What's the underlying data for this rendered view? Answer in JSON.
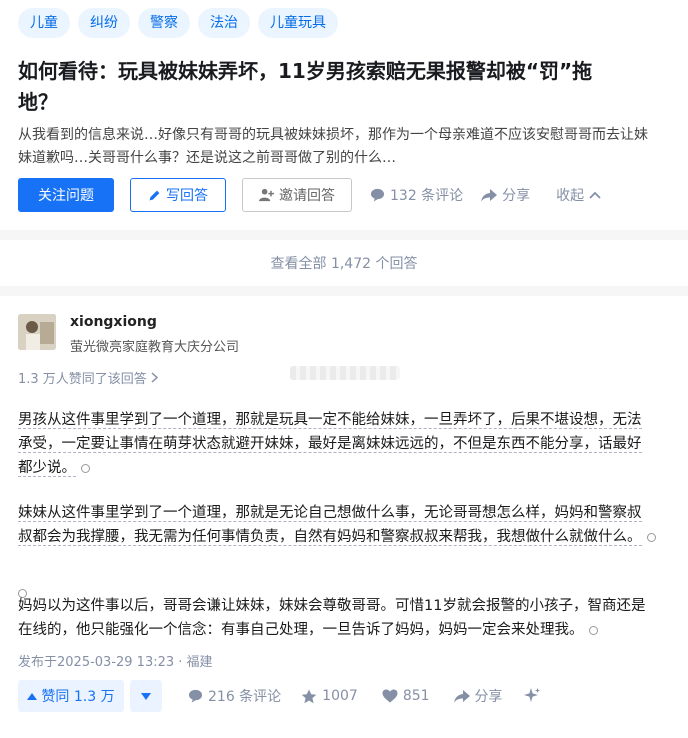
{
  "question": {
    "tags": [
      "儿童",
      "纠纷",
      "警察",
      "法治",
      "儿童玩具"
    ],
    "title_line1": "如何看待：玩具被妹妹弄坏，11岁男孩索赔无果报警却被“罚”拖",
    "title_line2": "地？",
    "desc_line1": "从我看到的信息来说…好像只有哥哥的玩具被妹妹损坏，那作为一个母亲难道不应该安慰哥哥而去让妹",
    "desc_line2": "妹道歉吗…关哥哥什么事？还是说这之前哥哥做了别的什么…",
    "follow_label": "关注问题",
    "write_label": "写回答",
    "invite_label": "邀请回答",
    "comments_label": "132 条评论",
    "share_label": "分享",
    "collapse_label": "收起"
  },
  "view_all": "查看全部 1,472 个回答",
  "answer": {
    "author": "xiongxiong",
    "bio": "萤光微亮家庭教育大庆分公司",
    "agree_summary": "1.3 万人赞同了该回答",
    "paragraphs": [
      {
        "lines": [
          "男孩从这件事里学到了一个道理，那就是玩具一定不能给妹妹，一旦弄坏了，后果不堪设想，无法",
          "承受，一定要让事情在萌芽状态就避开妹妹，最好是离妹妹远远的，不但是东西不能分享，话最好",
          "都少说。"
        ]
      },
      {
        "lines": [
          "妹妹从这件事里学到了一个道理，那就是无论自己想做什么事，无论哥哥想怎么样，妈妈和警察叔",
          "叔都会为我撑腰，我无需为任何事情负责，自然有妈妈和警察叔叔来帮我，我想做什么就做什么。"
        ]
      },
      {
        "lines": [
          "妈妈以为这件事以后，哥哥会谦让妹妹，妹妹会尊敬哥哥。可惜11岁就会报警的小孩子，智商还是",
          "在线的，他只能强化一个信念：有事自己处理，一旦告诉了妈妈，妈妈一定会来处理我。"
        ]
      }
    ],
    "published": "发布于2025-03-29 13:23 · 福建",
    "vote_label": "赞同 1.3 万",
    "comments_label": "216 条评论",
    "likes": "1007",
    "hearts": "851",
    "share_label": "分享"
  }
}
